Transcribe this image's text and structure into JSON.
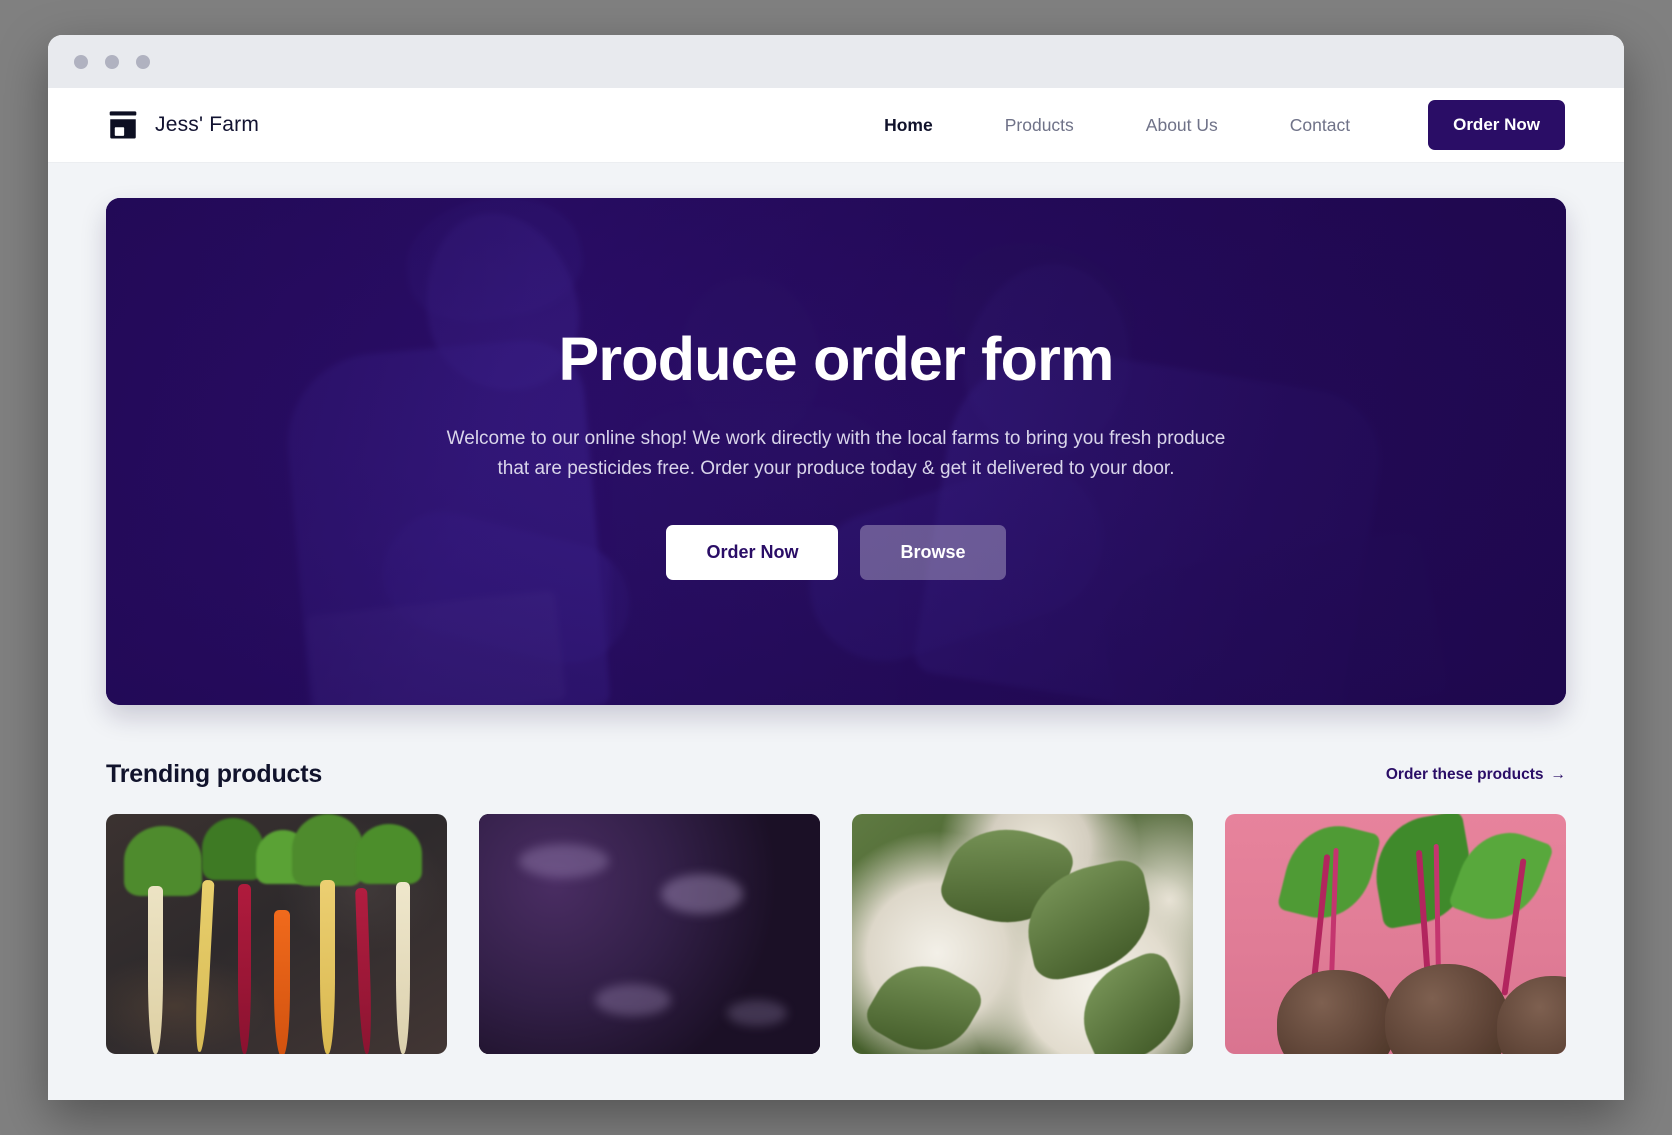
{
  "window": {
    "traffic_lights": [
      "close",
      "minimize",
      "maximize"
    ]
  },
  "nav": {
    "brand": {
      "icon": "storefront-icon",
      "name": "Jess' Farm"
    },
    "links": [
      {
        "label": "Home",
        "active": true
      },
      {
        "label": "Products",
        "active": false
      },
      {
        "label": "About Us",
        "active": false
      },
      {
        "label": "Contact",
        "active": false
      }
    ],
    "cta_label": "Order Now"
  },
  "hero": {
    "title": "Produce order form",
    "subtitle": "Welcome to our online shop! We work directly with the local farms to bring you fresh produce that are pesticides free. Order your produce today & get it delivered to your door.",
    "primary_button": "Order Now",
    "secondary_button": "Browse"
  },
  "trending": {
    "title": "Trending products",
    "link_label": "Order these products",
    "link_arrow": "→",
    "products": [
      {
        "name": "heirloom-carrots"
      },
      {
        "name": "purple-cabbage"
      },
      {
        "name": "cauliflower"
      },
      {
        "name": "beetroot"
      }
    ]
  },
  "colors": {
    "brand_purple": "#2a0d66",
    "page_background": "#f2f4f7",
    "titlebar": "#e8eaee",
    "nav_text": "#6f7288",
    "heading": "#11132c",
    "outer_background": "#808080"
  }
}
